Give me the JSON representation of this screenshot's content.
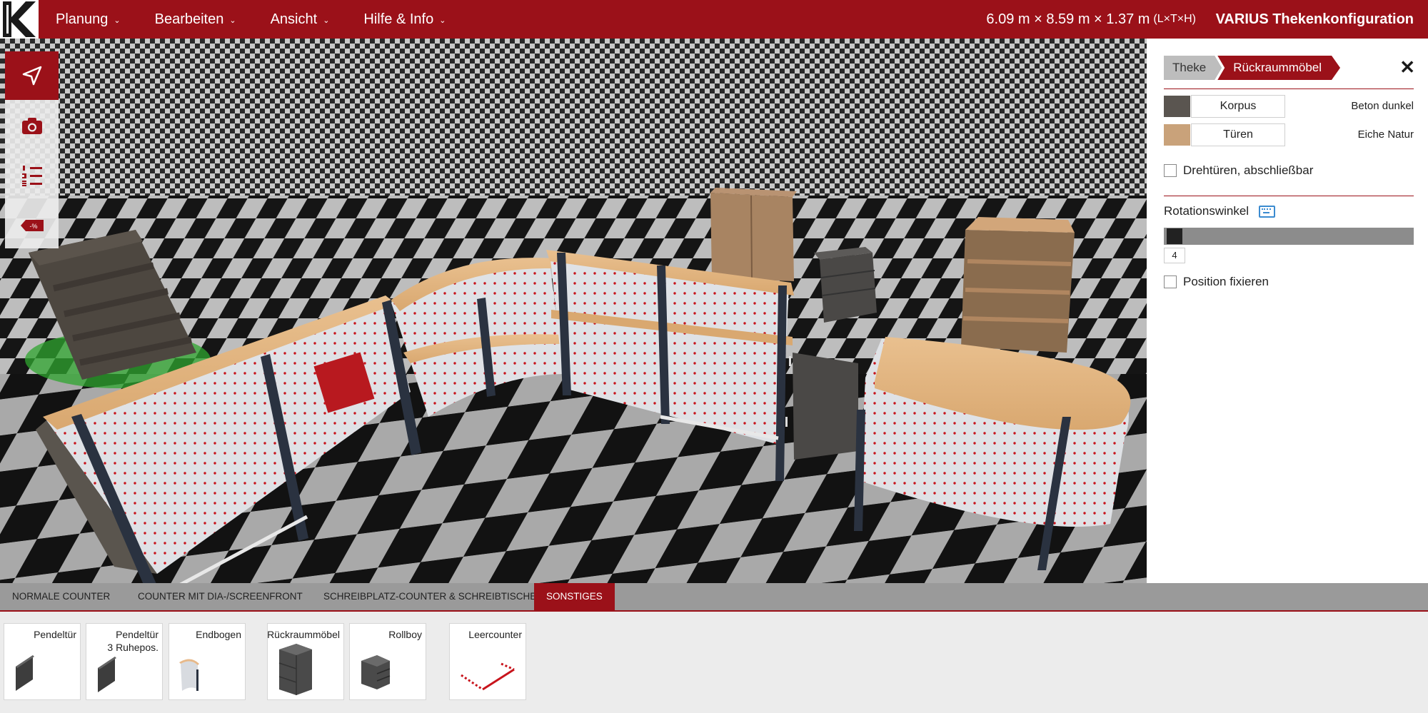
{
  "header": {
    "menu": [
      {
        "label": "Planung"
      },
      {
        "label": "Bearbeiten"
      },
      {
        "label": "Ansicht"
      },
      {
        "label": "Hilfe & Info"
      }
    ],
    "dimensions": "6.09 m × 8.59 m × 1.37 m",
    "dimensions_unit": "(L×T×H)",
    "app_title": "VARIUS Thekenkonfiguration"
  },
  "toolbar": {
    "tools": [
      {
        "icon": "navigate-arrow-icon",
        "active": true
      },
      {
        "icon": "camera-icon",
        "active": false
      },
      {
        "icon": "numbered-list-icon",
        "active": false
      },
      {
        "icon": "discount-tag-icon",
        "active": false
      }
    ],
    "discount_label": "-%"
  },
  "panel": {
    "breadcrumb": [
      {
        "label": "Theke"
      },
      {
        "label": "Rückraummöbel"
      }
    ],
    "close_label": "✕",
    "materials": [
      {
        "button": "Korpus",
        "value": "Beton dunkel",
        "color": "#5a5550"
      },
      {
        "button": "Türen",
        "value": "Eiche Natur",
        "color": "#c9a27a"
      }
    ],
    "option_lockable": "Drehtüren, abschließbar",
    "rotation_label": "Rotationswinkel",
    "rotation_value": "4",
    "rotation_max": 360,
    "option_fix_position": "Position fixieren",
    "accent": "#9b1119"
  },
  "tabs": [
    {
      "label": "Normale Counter",
      "active": false
    },
    {
      "label": "Counter mit Dia-/Screenfront",
      "active": false
    },
    {
      "label": "Schreibplatz-Counter & Schreibtische",
      "active": false
    },
    {
      "label": "Sonstiges",
      "active": true
    }
  ],
  "palette": [
    {
      "label": "Pendeltür",
      "label2": ""
    },
    {
      "label": "Pendeltür",
      "label2": "3 Ruhepos."
    },
    {
      "label": "Endbogen",
      "label2": ""
    },
    {
      "label": "Rückraummöbel",
      "label2": ""
    },
    {
      "label": "Rollboy",
      "label2": ""
    },
    {
      "label": "Leercounter",
      "label2": ""
    }
  ]
}
